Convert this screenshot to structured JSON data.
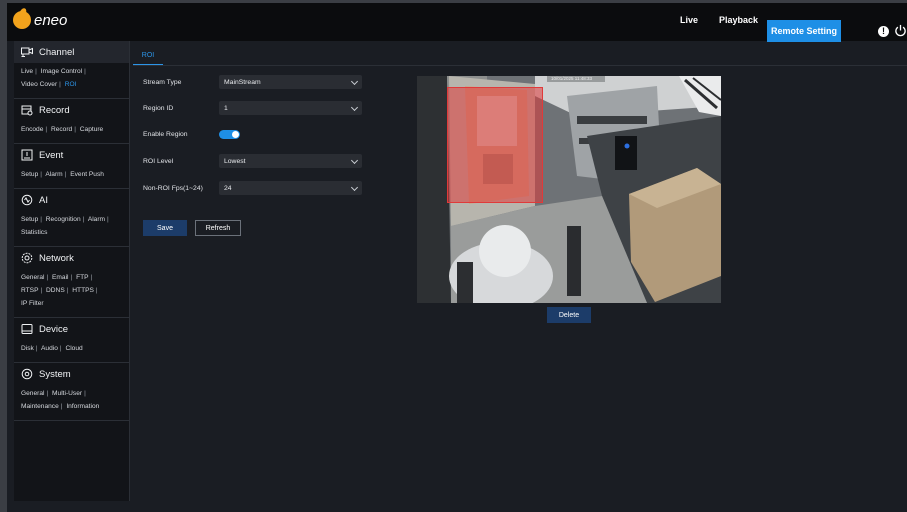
{
  "brand": {
    "name": "eneo"
  },
  "nav": {
    "live": "Live",
    "playback": "Playback",
    "remote_setting": "Remote Setting"
  },
  "colors": {
    "accent": "#1e8fe6",
    "roi_region": "#e03a3a",
    "button_primary": "#1c3c69"
  },
  "sidebar": {
    "sections": [
      {
        "title": "Channel",
        "icon": "camera-icon",
        "links": [
          "Live",
          "Image Control",
          "Video Cover",
          "ROI"
        ],
        "active_link": "ROI"
      },
      {
        "title": "Record",
        "icon": "record-icon",
        "links": [
          "Encode",
          "Record",
          "Capture"
        ]
      },
      {
        "title": "Event",
        "icon": "event-icon",
        "links": [
          "Setup",
          "Alarm",
          "Event Push"
        ]
      },
      {
        "title": "AI",
        "icon": "ai-icon",
        "links": [
          "Setup",
          "Recognition",
          "Alarm",
          "Statistics"
        ]
      },
      {
        "title": "Network",
        "icon": "network-icon",
        "links": [
          "General",
          "Email",
          "FTP",
          "RTSP",
          "DDNS",
          "HTTPS",
          "IP Filter"
        ]
      },
      {
        "title": "Device",
        "icon": "device-icon",
        "links": [
          "Disk",
          "Audio",
          "Cloud"
        ]
      },
      {
        "title": "System",
        "icon": "system-icon",
        "links": [
          "General",
          "Multi-User",
          "Maintenance",
          "Information"
        ]
      }
    ]
  },
  "tab": {
    "label": "ROI"
  },
  "form": {
    "stream_type": {
      "label": "Stream Type",
      "value": "MainStream"
    },
    "region_id": {
      "label": "Region ID",
      "value": "1"
    },
    "enable_region": {
      "label": "Enable Region",
      "value": true
    },
    "roi_level": {
      "label": "ROI Level",
      "value": "Lowest"
    },
    "non_roi_fps": {
      "label": "Non-ROI Fps(1~24)",
      "value": "24"
    }
  },
  "buttons": {
    "save": "Save",
    "refresh": "Refresh",
    "delete": "Delete"
  },
  "preview": {
    "timestamp": "10/01/2025 11:48:33"
  }
}
